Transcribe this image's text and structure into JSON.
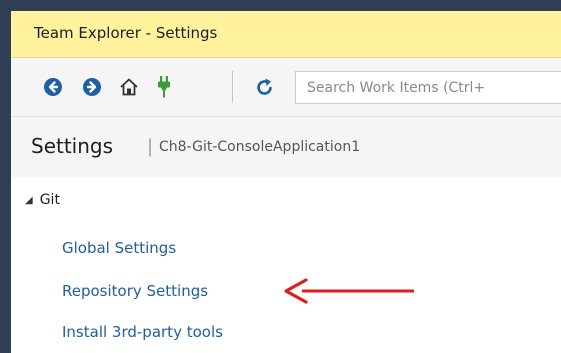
{
  "window": {
    "title": "Team Explorer - Settings"
  },
  "toolbar": {
    "icons": [
      "back-icon",
      "forward-icon",
      "home-icon",
      "connect-icon",
      "refresh-icon"
    ],
    "search_placeholder": "Search Work Items (Ctrl+"
  },
  "header": {
    "title": "Settings",
    "separator": "|",
    "context": "Ch8-Git-ConsoleApplication1"
  },
  "section": {
    "title": "Git",
    "expanded": true,
    "links": [
      {
        "label": "Global Settings"
      },
      {
        "label": "Repository Settings"
      },
      {
        "label": "Install 3rd-party tools"
      }
    ]
  },
  "annotation": {
    "arrow_color": "#e41b1b",
    "points_to": "Repository Settings"
  },
  "colors": {
    "title_bar": "#fff29d",
    "frame": "#2f3e54",
    "nav_icon": "#1e5fa8",
    "connect_icon": "#3f9c35",
    "link": "#1e5fa8"
  }
}
